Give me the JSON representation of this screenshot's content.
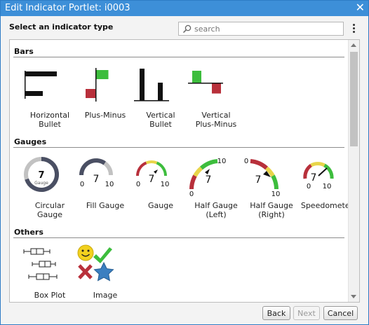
{
  "window": {
    "title": "Edit Indicator Portlet: i0003"
  },
  "header": {
    "heading": "Select an indicator type",
    "search_placeholder": "search"
  },
  "sections": {
    "bars": {
      "title": "Bars",
      "items": [
        {
          "label_line1": "Horizontal",
          "label_line2": "Bullet"
        },
        {
          "label_line1": "Plus-Minus",
          "label_line2": ""
        },
        {
          "label_line1": "Vertical",
          "label_line2": "Bullet"
        },
        {
          "label_line1": "Vertical",
          "label_line2": "Plus-Minus"
        }
      ]
    },
    "gauges": {
      "title": "Gauges",
      "items": [
        {
          "label_line1": "Circular",
          "label_line2": "Gauge",
          "value": "7",
          "caption": "Gauge"
        },
        {
          "label_line1": "Fill Gauge",
          "label_line2": "",
          "value": "7",
          "min": "0",
          "max": "10"
        },
        {
          "label_line1": "Gauge",
          "label_line2": "",
          "value": "7",
          "min": "0",
          "max": "10"
        },
        {
          "label_line1": "Half Gauge",
          "label_line2": "(Left)",
          "value": "7",
          "min": "0",
          "max": "10"
        },
        {
          "label_line1": "Half Gauge",
          "label_line2": "(Right)",
          "value": "7",
          "min": "0",
          "max": "10"
        },
        {
          "label_line1": "Speedometer",
          "label_line2": "",
          "value": "7",
          "min": "0",
          "max": "10"
        }
      ]
    },
    "others": {
      "title": "Others",
      "items": [
        {
          "label_line1": "Box Plot",
          "label_line2": ""
        },
        {
          "label_line1": "Image",
          "label_line2": ""
        }
      ]
    }
  },
  "footer": {
    "back_label": "Back",
    "next_label": "Next",
    "cancel_label": "Cancel"
  },
  "colors": {
    "titlebar": "#3d8fd8",
    "green": "#3dbd3d",
    "red": "#b8303b",
    "yellow": "#e8d54a",
    "star": "#3b7fc0",
    "gauge_dark": "#4a4f63"
  }
}
